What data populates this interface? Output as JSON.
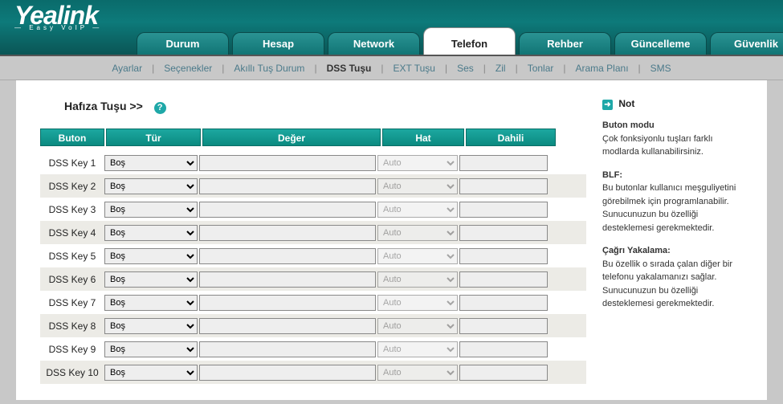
{
  "brand": {
    "name": "Yealink",
    "tagline": "— Easy VoIP —"
  },
  "main_tabs": [
    "Durum",
    "Hesap",
    "Network",
    "Telefon",
    "Rehber",
    "Güncelleme",
    "Güvenlik"
  ],
  "main_tab_active": 3,
  "subnav": [
    "Ayarlar",
    "Seçenekler",
    "Akıllı Tuş Durum",
    "DSS Tuşu",
    "EXT Tuşu",
    "Ses",
    "Zil",
    "Tonlar",
    "Arama Planı",
    "SMS"
  ],
  "subnav_active": 3,
  "page_title": "Hafıza Tuşu >>",
  "grid_headers": [
    "Buton",
    "Tür",
    "Değer",
    "Hat",
    "Dahili"
  ],
  "type_options": [
    "Boş"
  ],
  "host_options": [
    "Auto"
  ],
  "rows": [
    {
      "label": "DSS Key 1",
      "type": "Boş",
      "value": "",
      "host": "Auto",
      "dahili": ""
    },
    {
      "label": "DSS Key 2",
      "type": "Boş",
      "value": "",
      "host": "Auto",
      "dahili": ""
    },
    {
      "label": "DSS Key 3",
      "type": "Boş",
      "value": "",
      "host": "Auto",
      "dahili": ""
    },
    {
      "label": "DSS Key 4",
      "type": "Boş",
      "value": "",
      "host": "Auto",
      "dahili": ""
    },
    {
      "label": "DSS Key 5",
      "type": "Boş",
      "value": "",
      "host": "Auto",
      "dahili": ""
    },
    {
      "label": "DSS Key 6",
      "type": "Boş",
      "value": "",
      "host": "Auto",
      "dahili": ""
    },
    {
      "label": "DSS Key 7",
      "type": "Boş",
      "value": "",
      "host": "Auto",
      "dahili": ""
    },
    {
      "label": "DSS Key 8",
      "type": "Boş",
      "value": "",
      "host": "Auto",
      "dahili": ""
    },
    {
      "label": "DSS Key 9",
      "type": "Boş",
      "value": "",
      "host": "Auto",
      "dahili": ""
    },
    {
      "label": "DSS Key 10",
      "type": "Boş",
      "value": "",
      "host": "Auto",
      "dahili": ""
    }
  ],
  "notes": {
    "header": "Not",
    "sections": [
      {
        "title": "Buton modu",
        "text": "Çok fonksiyonlu tuşları farklı modlarda kullanabilirsiniz."
      },
      {
        "title": "BLF:",
        "text": "Bu butonlar kullanıcı meşguliyetini görebilmek için programlanabilir. Sunucunuzun bu özelliği desteklemesi gerekmektedir."
      },
      {
        "title": "Çağrı Yakalama:",
        "text": "Bu özellik o sırada çalan diğer bir telefonu yakalamanızı sağlar. Sunucunuzun bu özelliği desteklemesi gerekmektedir."
      }
    ]
  }
}
